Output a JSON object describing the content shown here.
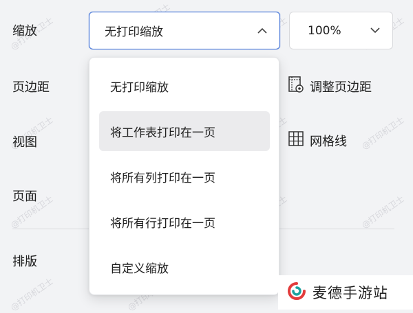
{
  "rows": {
    "scale_label": "缩放",
    "margins_label": "页边距",
    "view_label": "视图",
    "page_label": "页面",
    "layout_label": "排版"
  },
  "scale_select": {
    "value": "无打印缩放"
  },
  "zoom_select": {
    "value": "100%"
  },
  "right_items": {
    "adjust_margins": "调整页边距",
    "gridlines": "网格线"
  },
  "menu": {
    "items": [
      {
        "label": "无打印缩放"
      },
      {
        "label": "将工作表打印在一页"
      },
      {
        "label": "将所有列打印在一页"
      },
      {
        "label": "将所有行打印在一页"
      },
      {
        "label": "自定义缩放"
      }
    ],
    "highlighted_index": 1
  },
  "watermark": {
    "text": "@打印机卫士"
  },
  "brand": {
    "name": "麦德手游站",
    "logo_colors": [
      "#e23c3c",
      "#1aa3a0"
    ]
  },
  "colors": {
    "accent": "#3d6fd6",
    "background": "#f2f3f5",
    "highlight": "#ebebed"
  }
}
